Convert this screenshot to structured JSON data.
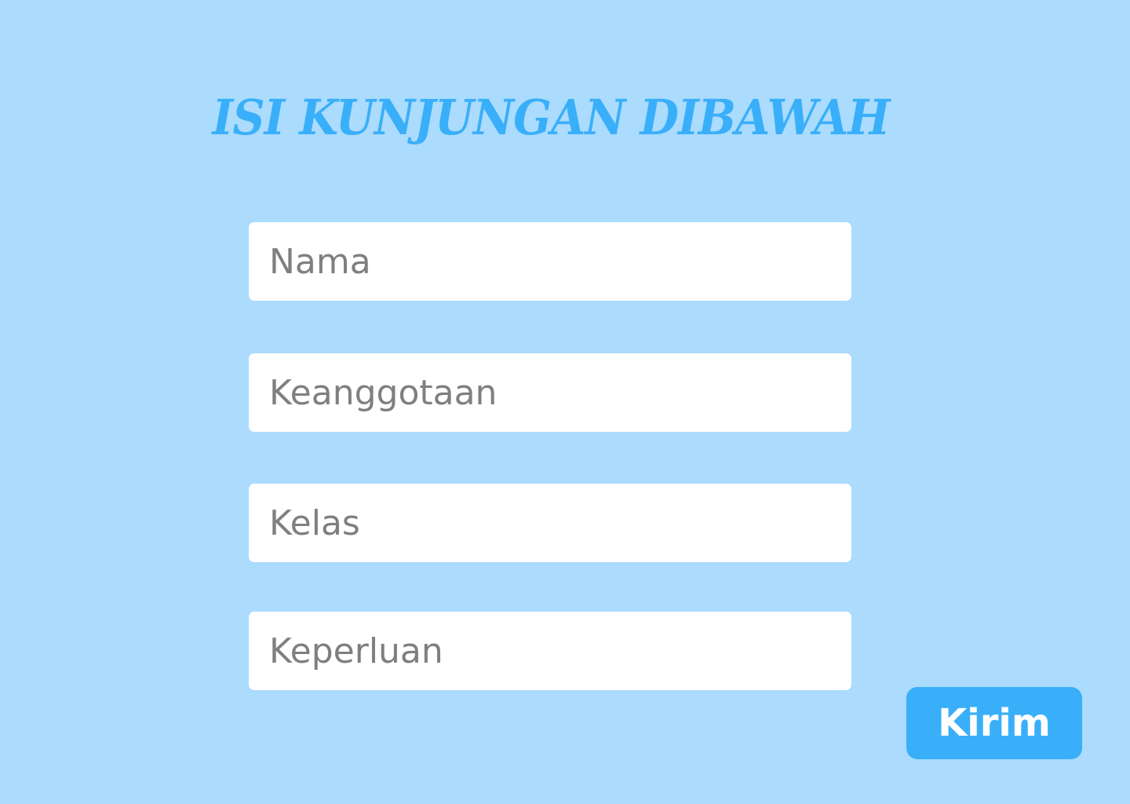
{
  "header": {
    "title": "ISI KUNJUNGAN DIBAWAH"
  },
  "form": {
    "fields": [
      {
        "placeholder": "Nama",
        "value": ""
      },
      {
        "placeholder": "Keanggotaan",
        "value": ""
      },
      {
        "placeholder": "Kelas",
        "value": ""
      },
      {
        "placeholder": "Keperluan",
        "value": ""
      }
    ],
    "submit_label": "Kirim"
  },
  "colors": {
    "background": "#abdbfd",
    "accent": "#3aaff9",
    "field_background": "#ffffff",
    "placeholder": "#7f7f7f"
  }
}
